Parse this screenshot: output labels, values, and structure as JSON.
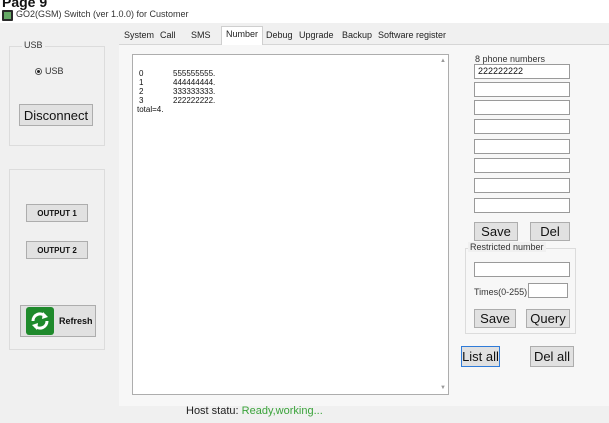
{
  "page_label": "Page 9",
  "window": {
    "title": "GO2(GSM) Switch (ver 1.0.0) for Customer"
  },
  "usb_panel": {
    "group_label": "USB",
    "radio_label": "USB",
    "disconnect_label": "Disconnect"
  },
  "output_panel": {
    "output1_label": "OUTPUT 1",
    "output2_label": "OUTPUT 2",
    "refresh_label": "Refresh"
  },
  "tabs": [
    "System",
    "Call",
    "SMS",
    "Number",
    "Debug",
    "Upgrade",
    "Backup",
    "Software register"
  ],
  "active_tab": "Number",
  "number_list": {
    "rows": [
      {
        "index": "0",
        "number": "555555555."
      },
      {
        "index": "1",
        "number": "444444444."
      },
      {
        "index": "2",
        "number": "333333333."
      },
      {
        "index": "3",
        "number": "222222222."
      }
    ],
    "total_text": "total=4."
  },
  "phone_numbers": {
    "label": "8 phone numbers",
    "values": [
      "222222222",
      "",
      "",
      "",
      "",
      "",
      "",
      ""
    ],
    "save_label": "Save",
    "del_label": "Del"
  },
  "restricted": {
    "group_label": "Restricted number",
    "number_value": "",
    "times_label": "Times(0-255)",
    "times_value": "",
    "save_label": "Save",
    "query_label": "Query"
  },
  "list_all_label": "List all",
  "del_all_label": "Del all",
  "status": {
    "prefix": "Host statu:",
    "value": "Ready,working..."
  }
}
